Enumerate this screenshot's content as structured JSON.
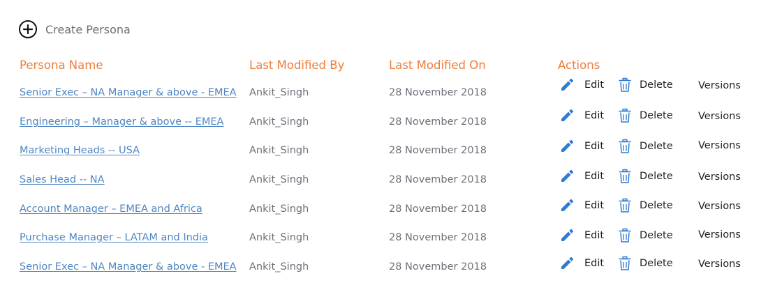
{
  "create": {
    "label": "Create Persona",
    "icon": "plus-circle"
  },
  "table": {
    "headers": {
      "name": "Persona Name",
      "modified_by": "Last Modified By",
      "modified_on": "Last Modified On",
      "actions": "Actions"
    },
    "rows": [
      {
        "name": "Senior Exec – NA Manager & above - EMEA",
        "modified_by": "Ankit_Singh",
        "modified_on": "28 November 2018"
      },
      {
        "name": "Engineering – Manager & above -- EMEA",
        "modified_by": "Ankit_Singh",
        "modified_on": "28 November 2018"
      },
      {
        "name": "Marketing Heads -- USA",
        "modified_by": "Ankit_Singh",
        "modified_on": "28 November 2018"
      },
      {
        "name": "Sales Head -- NA",
        "modified_by": "Ankit_Singh",
        "modified_on": "28 November 2018"
      },
      {
        "name": "Account Manager – EMEA and Africa",
        "modified_by": "Ankit_Singh",
        "modified_on": "28 November 2018"
      },
      {
        "name": "Purchase Manager – LATAM and India",
        "modified_by": "Ankit_Singh",
        "modified_on": "28 November 2018"
      },
      {
        "name": "Senior Exec – NA Manager & above - EMEA",
        "modified_by": "Ankit_Singh",
        "modified_on": "28 November 2018"
      }
    ],
    "actions": {
      "edit_label": "Edit",
      "delete_label": "Delete",
      "versions_label": "Versions",
      "edit_icon": "pencil-icon",
      "delete_icon": "trash-icon"
    }
  },
  "colors": {
    "header": "#ec7d3a",
    "link": "#4f86c2",
    "muted_text": "#6b7179",
    "icon_blue": "#2e7bd1",
    "action_text": "#1d1f21"
  }
}
